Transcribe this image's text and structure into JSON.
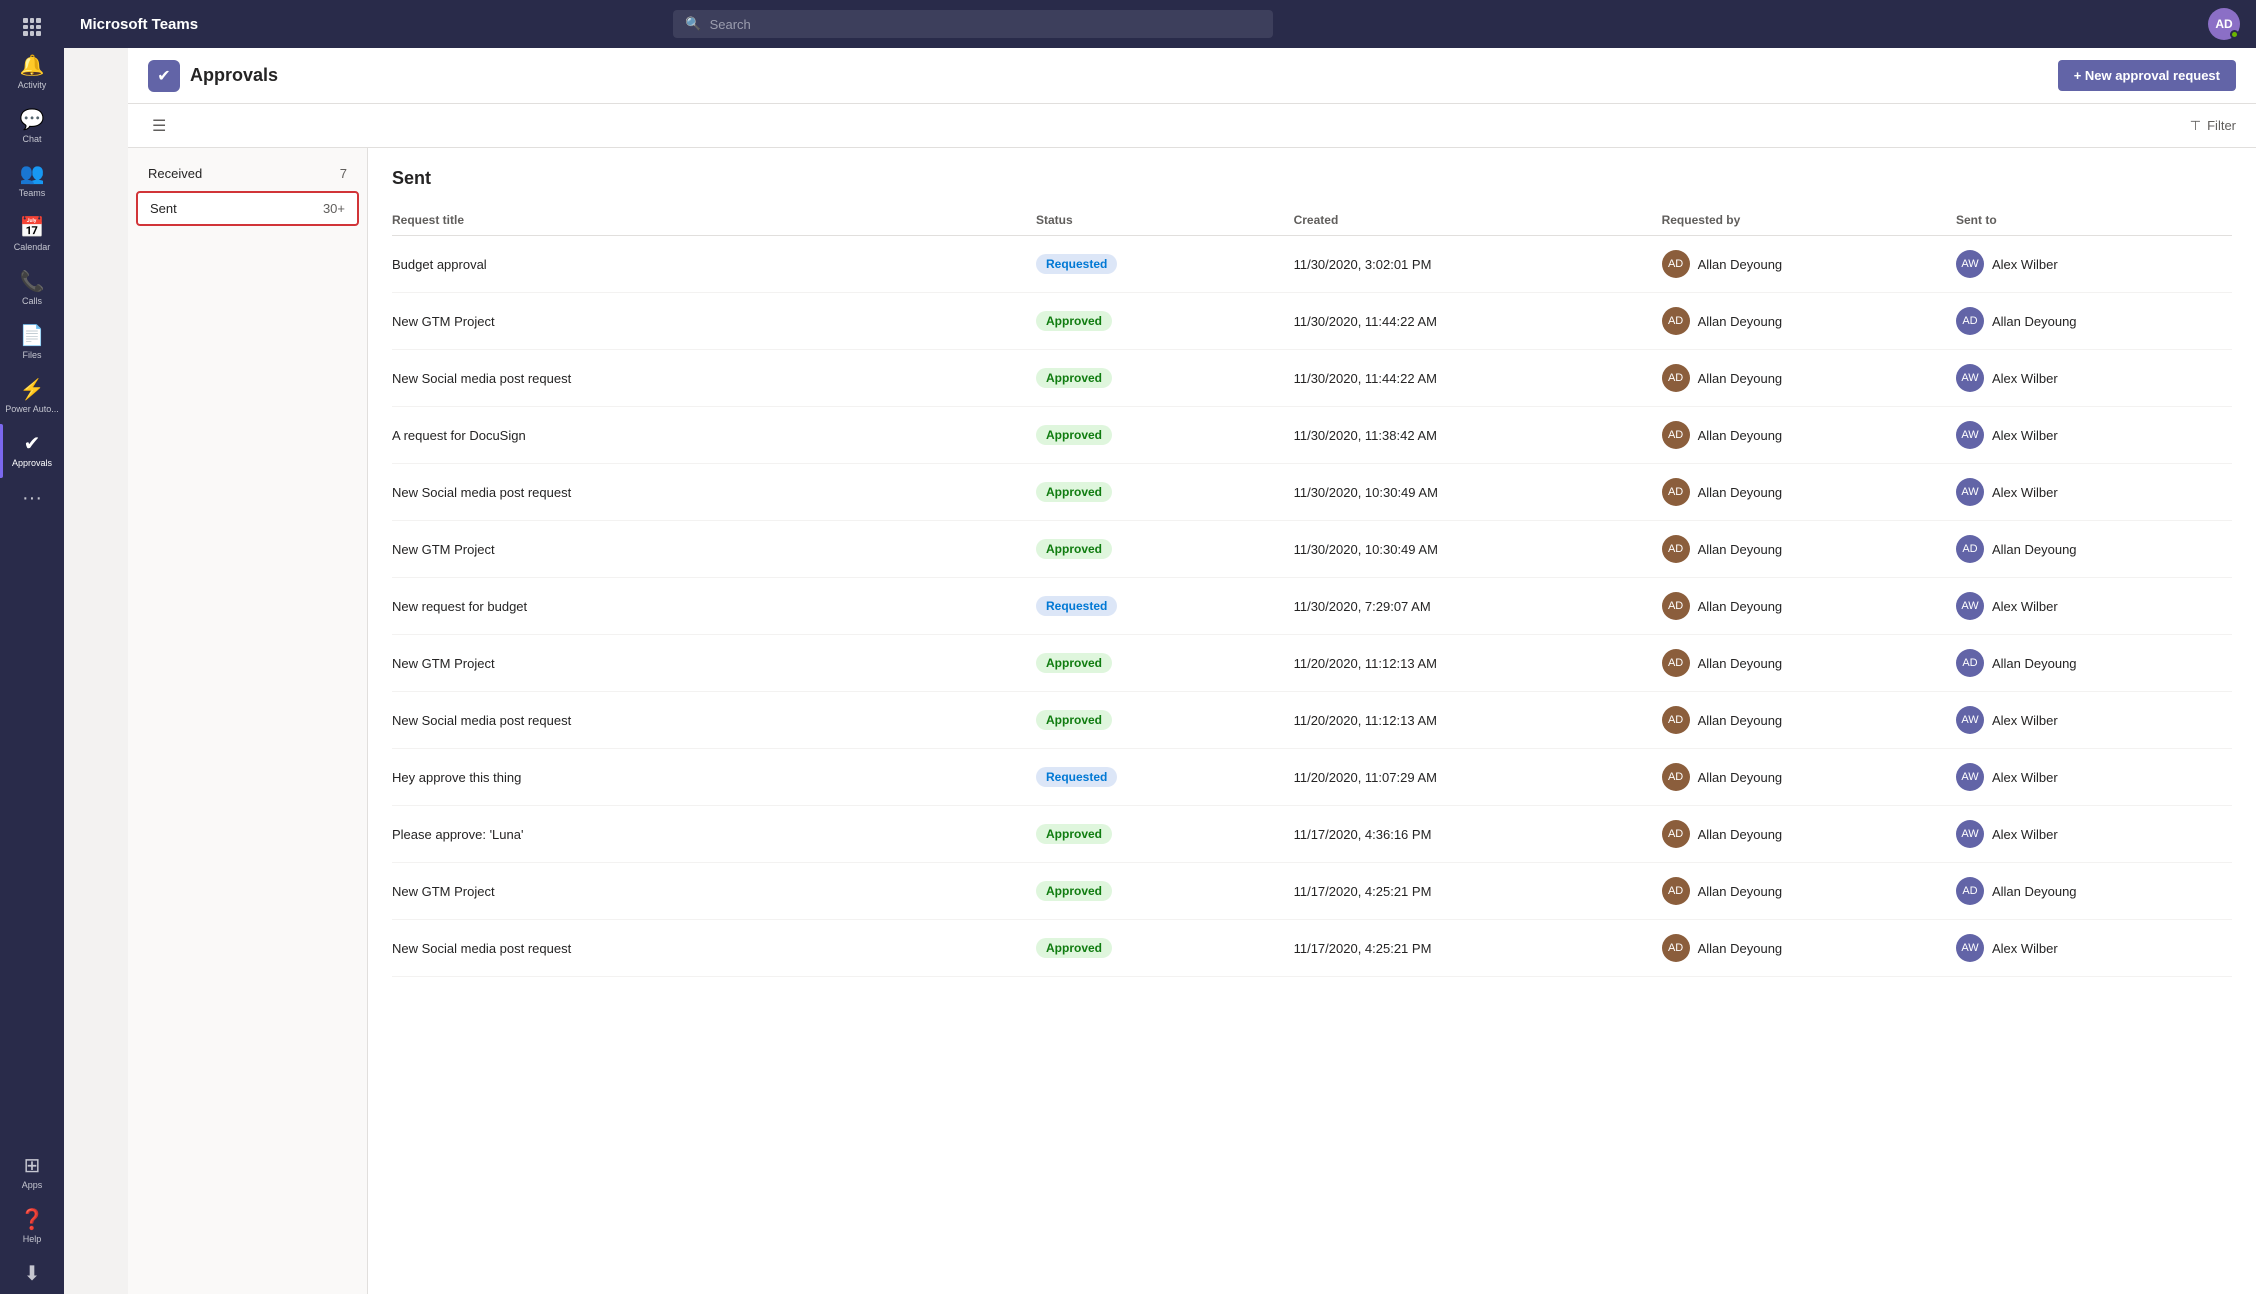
{
  "app": {
    "title": "Microsoft Teams"
  },
  "search": {
    "placeholder": "Search"
  },
  "sidebar": {
    "items": [
      {
        "id": "grid",
        "label": "",
        "icon": "grid"
      },
      {
        "id": "activity",
        "label": "Activity",
        "icon": "activity"
      },
      {
        "id": "chat",
        "label": "Chat",
        "icon": "chat"
      },
      {
        "id": "teams",
        "label": "Teams",
        "icon": "teams"
      },
      {
        "id": "calendar",
        "label": "Calendar",
        "icon": "calendar"
      },
      {
        "id": "calls",
        "label": "Calls",
        "icon": "calls"
      },
      {
        "id": "files",
        "label": "Files",
        "icon": "files"
      },
      {
        "id": "power-automate",
        "label": "Power Auto...",
        "icon": "power"
      },
      {
        "id": "approvals",
        "label": "Approvals",
        "icon": "approvals",
        "active": true
      },
      {
        "id": "more",
        "label": "...",
        "icon": "more"
      },
      {
        "id": "apps",
        "label": "Apps",
        "icon": "apps"
      },
      {
        "id": "help",
        "label": "Help",
        "icon": "help"
      },
      {
        "id": "download",
        "label": "",
        "icon": "download"
      }
    ]
  },
  "page": {
    "title": "Approvals",
    "new_button_label": "+ New approval request",
    "filter_label": "Filter",
    "hamburger_label": "☰"
  },
  "left_nav": {
    "items": [
      {
        "label": "Received",
        "count": "7",
        "active": false
      },
      {
        "label": "Sent",
        "count": "30+",
        "active": true
      }
    ]
  },
  "table": {
    "section_title": "Sent",
    "columns": [
      "Request title",
      "Status",
      "Created",
      "Requested by",
      "Sent to"
    ],
    "rows": [
      {
        "title": "Budget approval",
        "status": "Requested",
        "status_type": "requested",
        "created": "11/30/2020, 3:02:01 PM",
        "requested_by": "Allan Deyoung",
        "sent_to": "Alex Wilber"
      },
      {
        "title": "New GTM Project",
        "status": "Approved",
        "status_type": "approved",
        "created": "11/30/2020, 11:44:22 AM",
        "requested_by": "Allan Deyoung",
        "sent_to": "Allan Deyoung"
      },
      {
        "title": "New Social media post request",
        "status": "Approved",
        "status_type": "approved",
        "created": "11/30/2020, 11:44:22 AM",
        "requested_by": "Allan Deyoung",
        "sent_to": "Alex Wilber"
      },
      {
        "title": "A request for DocuSign",
        "status": "Approved",
        "status_type": "approved",
        "created": "11/30/2020, 11:38:42 AM",
        "requested_by": "Allan Deyoung",
        "sent_to": "Alex Wilber"
      },
      {
        "title": "New Social media post request",
        "status": "Approved",
        "status_type": "approved",
        "created": "11/30/2020, 10:30:49 AM",
        "requested_by": "Allan Deyoung",
        "sent_to": "Alex Wilber"
      },
      {
        "title": "New GTM Project",
        "status": "Approved",
        "status_type": "approved",
        "created": "11/30/2020, 10:30:49 AM",
        "requested_by": "Allan Deyoung",
        "sent_to": "Allan Deyoung"
      },
      {
        "title": "New request for budget",
        "status": "Requested",
        "status_type": "requested",
        "created": "11/30/2020, 7:29:07 AM",
        "requested_by": "Allan Deyoung",
        "sent_to": "Alex Wilber"
      },
      {
        "title": "New GTM Project",
        "status": "Approved",
        "status_type": "approved",
        "created": "11/20/2020, 11:12:13 AM",
        "requested_by": "Allan Deyoung",
        "sent_to": "Allan Deyoung"
      },
      {
        "title": "New Social media post request",
        "status": "Approved",
        "status_type": "approved",
        "created": "11/20/2020, 11:12:13 AM",
        "requested_by": "Allan Deyoung",
        "sent_to": "Alex Wilber"
      },
      {
        "title": "Hey approve this thing",
        "status": "Requested",
        "status_type": "requested",
        "created": "11/20/2020, 11:07:29 AM",
        "requested_by": "Allan Deyoung",
        "sent_to": "Alex Wilber"
      },
      {
        "title": "Please approve: 'Luna'",
        "status": "Approved",
        "status_type": "approved",
        "created": "11/17/2020, 4:36:16 PM",
        "requested_by": "Allan Deyoung",
        "sent_to": "Alex Wilber"
      },
      {
        "title": "New GTM Project",
        "status": "Approved",
        "status_type": "approved",
        "created": "11/17/2020, 4:25:21 PM",
        "requested_by": "Allan Deyoung",
        "sent_to": "Allan Deyoung"
      },
      {
        "title": "New Social media post request",
        "status": "Approved",
        "status_type": "approved",
        "created": "11/17/2020, 4:25:21 PM",
        "requested_by": "Allan Deyoung",
        "sent_to": "Alex Wilber"
      }
    ]
  }
}
